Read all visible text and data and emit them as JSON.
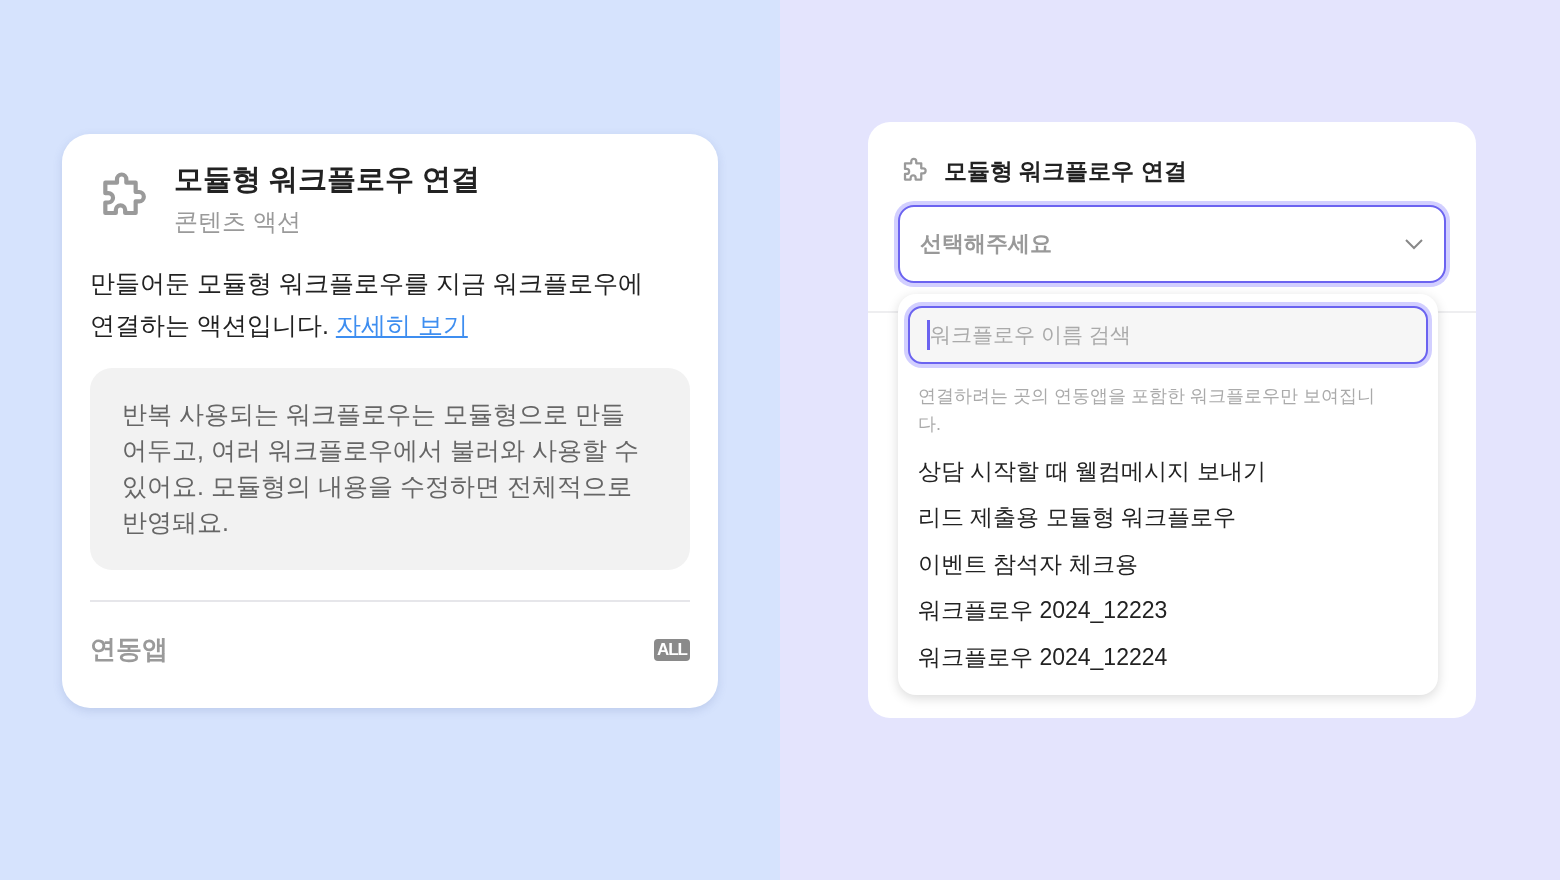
{
  "left_card": {
    "title": "모듈형 워크플로우 연결",
    "subtitle": "콘텐츠 액션",
    "description": "만들어둔 모듈형 워크플로우를 지금 워크플로우에 연결하는 액션입니다.",
    "link": "자세히 보기",
    "note": "반복 사용되는 워크플로우는 모듈형으로 만들어두고, 여러 워크플로우에서 불러와 사용할 수 있어요. 모듈형의 내용을 수정하면 전체적으로 반영돼요.",
    "footer_label": "연동앱",
    "footer_badge": "ALL"
  },
  "right_card": {
    "title": "모듈형 워크플로우 연결",
    "select": {
      "placeholder": "선택해주세요",
      "expanded": true
    },
    "dropdown": {
      "search": {
        "placeholder": "워크플로우 이름 검색",
        "focused": true
      },
      "hint": "연결하려는 곳의 연동앱을 포함한 워크플로우만 보여집니다.",
      "options": [
        {
          "label": "상담 시작할 때 웰컴메시지 보내기"
        },
        {
          "label": "리드 제출용 모듈형 워크플로우"
        },
        {
          "label": "이벤트 참석자 체크용"
        },
        {
          "label": "워크플로우 2024_12223"
        },
        {
          "label": "워크플로우 2024_12224"
        }
      ]
    }
  }
}
